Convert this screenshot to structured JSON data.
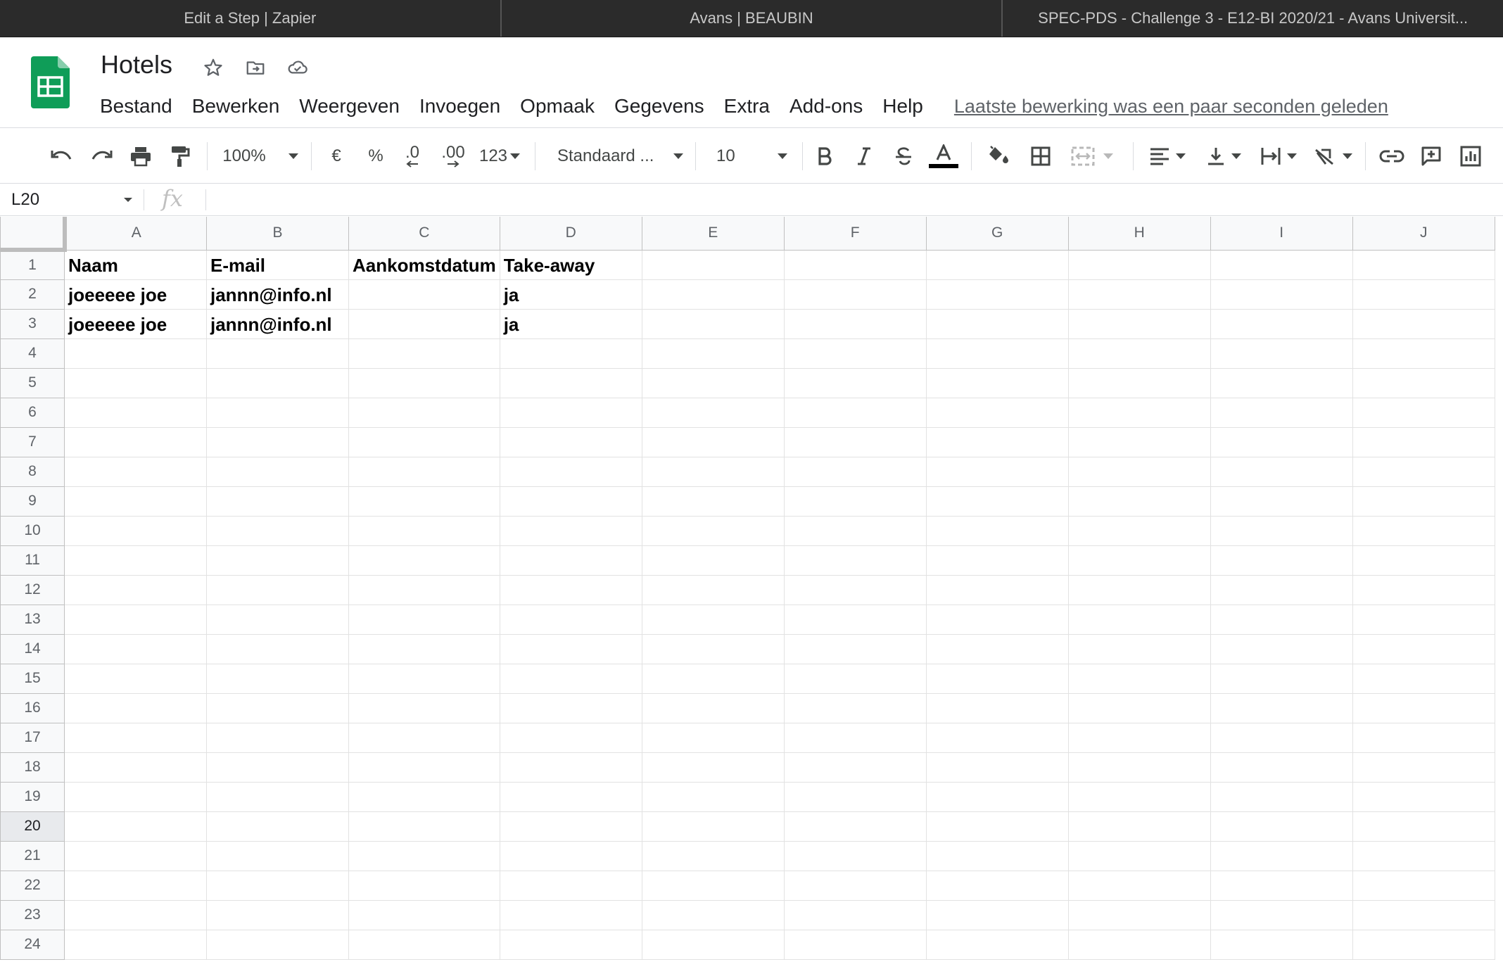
{
  "browser": {
    "tabs": [
      {
        "label": "Edit a Step | Zapier"
      },
      {
        "label": "Avans | BEAUBIN"
      },
      {
        "label": "SPEC-PDS - Challenge 3 - E12-BI 2020/21 - Avans Universit..."
      }
    ]
  },
  "header": {
    "title": "Hotels",
    "menu": [
      "Bestand",
      "Bewerken",
      "Weergeven",
      "Invoegen",
      "Opmaak",
      "Gegevens",
      "Extra",
      "Add-ons",
      "Help"
    ],
    "last_edit": "Laatste bewerking was een paar seconden geleden",
    "brand_color": "#0f9d58"
  },
  "toolbar": {
    "zoom": "100%",
    "currency": "€",
    "percent": "%",
    "decimal_decrease": ".0",
    "decimal_increase": ".00",
    "more_formats": "123",
    "font": "Standaard ...",
    "font_size": "10"
  },
  "formula_bar": {
    "name_box": "L20",
    "fx": "fx",
    "value": ""
  },
  "sheet": {
    "columns": [
      "A",
      "B",
      "C",
      "D",
      "E",
      "F",
      "G",
      "H",
      "I",
      "J"
    ],
    "rows": [
      {
        "num": "1",
        "cells": [
          "Naam",
          "E-mail",
          "Aankomstdatum",
          "Take-away",
          "",
          "",
          "",
          "",
          "",
          ""
        ]
      },
      {
        "num": "2",
        "cells": [
          "joeeeee joe",
          "jannn@info.nl",
          "",
          "ja",
          "",
          "",
          "",
          "",
          "",
          ""
        ]
      },
      {
        "num": "3",
        "cells": [
          "joeeeee joe",
          "jannn@info.nl",
          "",
          "ja",
          "",
          "",
          "",
          "",
          "",
          ""
        ]
      },
      {
        "num": "4",
        "cells": [
          "",
          "",
          "",
          "",
          "",
          "",
          "",
          "",
          "",
          ""
        ]
      },
      {
        "num": "5",
        "cells": [
          "",
          "",
          "",
          "",
          "",
          "",
          "",
          "",
          "",
          ""
        ]
      },
      {
        "num": "6",
        "cells": [
          "",
          "",
          "",
          "",
          "",
          "",
          "",
          "",
          "",
          ""
        ]
      },
      {
        "num": "7",
        "cells": [
          "",
          "",
          "",
          "",
          "",
          "",
          "",
          "",
          "",
          ""
        ]
      },
      {
        "num": "8",
        "cells": [
          "",
          "",
          "",
          "",
          "",
          "",
          "",
          "",
          "",
          ""
        ]
      },
      {
        "num": "9",
        "cells": [
          "",
          "",
          "",
          "",
          "",
          "",
          "",
          "",
          "",
          ""
        ]
      },
      {
        "num": "10",
        "cells": [
          "",
          "",
          "",
          "",
          "",
          "",
          "",
          "",
          "",
          ""
        ]
      },
      {
        "num": "11",
        "cells": [
          "",
          "",
          "",
          "",
          "",
          "",
          "",
          "",
          "",
          ""
        ]
      },
      {
        "num": "12",
        "cells": [
          "",
          "",
          "",
          "",
          "",
          "",
          "",
          "",
          "",
          ""
        ]
      },
      {
        "num": "13",
        "cells": [
          "",
          "",
          "",
          "",
          "",
          "",
          "",
          "",
          "",
          ""
        ]
      },
      {
        "num": "14",
        "cells": [
          "",
          "",
          "",
          "",
          "",
          "",
          "",
          "",
          "",
          ""
        ]
      },
      {
        "num": "15",
        "cells": [
          "",
          "",
          "",
          "",
          "",
          "",
          "",
          "",
          "",
          ""
        ]
      },
      {
        "num": "16",
        "cells": [
          "",
          "",
          "",
          "",
          "",
          "",
          "",
          "",
          "",
          ""
        ]
      },
      {
        "num": "17",
        "cells": [
          "",
          "",
          "",
          "",
          "",
          "",
          "",
          "",
          "",
          ""
        ]
      },
      {
        "num": "18",
        "cells": [
          "",
          "",
          "",
          "",
          "",
          "",
          "",
          "",
          "",
          ""
        ]
      },
      {
        "num": "19",
        "cells": [
          "",
          "",
          "",
          "",
          "",
          "",
          "",
          "",
          "",
          ""
        ]
      },
      {
        "num": "20",
        "cells": [
          "",
          "",
          "",
          "",
          "",
          "",
          "",
          "",
          "",
          ""
        ]
      },
      {
        "num": "21",
        "cells": [
          "",
          "",
          "",
          "",
          "",
          "",
          "",
          "",
          "",
          ""
        ]
      },
      {
        "num": "22",
        "cells": [
          "",
          "",
          "",
          "",
          "",
          "",
          "",
          "",
          "",
          ""
        ]
      },
      {
        "num": "23",
        "cells": [
          "",
          "",
          "",
          "",
          "",
          "",
          "",
          "",
          "",
          ""
        ]
      },
      {
        "num": "24",
        "cells": [
          "",
          "",
          "",
          "",
          "",
          "",
          "",
          "",
          "",
          ""
        ]
      }
    ],
    "selected_row": "20"
  }
}
